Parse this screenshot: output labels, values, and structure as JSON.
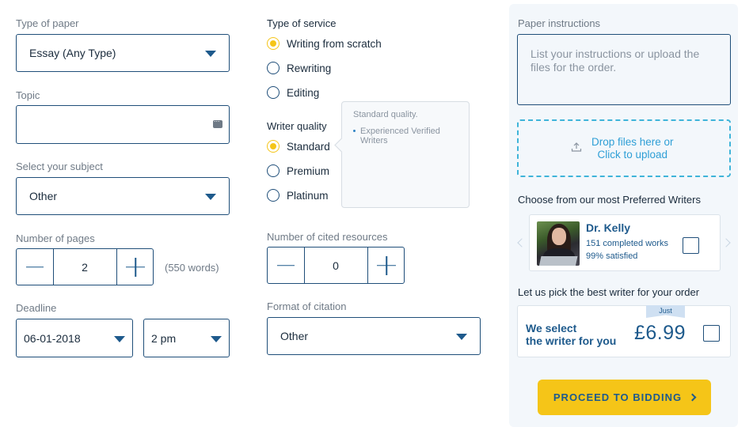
{
  "colors": {
    "accent": "#1e5a8c",
    "border": "#1f4e79",
    "highlight": "#f5c518",
    "muted": "#6f7a86",
    "panel_bg": "#f3f7fb",
    "link": "#2f9fd6"
  },
  "left": {
    "type_of_paper": {
      "label": "Type of paper",
      "value": "Essay (Any Type)"
    },
    "topic": {
      "label": "Topic",
      "value": ""
    },
    "subject": {
      "label": "Select your subject",
      "value": "Other"
    },
    "pages": {
      "label": "Number of pages",
      "value": "2",
      "words": "(550 words)"
    },
    "deadline": {
      "label": "Deadline",
      "date": "06-01-2018",
      "time": "2 pm"
    }
  },
  "middle": {
    "service": {
      "label": "Type of service",
      "options": [
        "Writing from scratch",
        "Rewriting",
        "Editing"
      ],
      "selected": "Writing from scratch"
    },
    "quality": {
      "label": "Writer quality",
      "options": [
        "Standard",
        "Premium",
        "Platinum"
      ],
      "selected": "Standard"
    },
    "tooltip": {
      "title": "Standard quality.",
      "items": [
        "Experienced Verified Writers"
      ]
    },
    "cited": {
      "label": "Number of cited resources",
      "value": "0"
    },
    "citation": {
      "label": "Format of citation",
      "value": "Other"
    }
  },
  "right": {
    "instructions": {
      "label": "Paper instructions",
      "placeholder": "List your instructions or upload the files for the order."
    },
    "upload": {
      "line1": "Drop files here or",
      "line2": "Click to upload"
    },
    "preferred": {
      "label": "Choose from our most Preferred Writers",
      "writer": {
        "name": "Dr. Kelly",
        "works": "151 completed works",
        "satisfied": "99% satisfied"
      }
    },
    "pick": {
      "label": "Let us pick the best writer for your order",
      "ribbon": "Just",
      "line1": "We select",
      "line2": "the writer for you",
      "price": "£6.99"
    },
    "proceed_label": "PROCEED TO BIDDING"
  }
}
